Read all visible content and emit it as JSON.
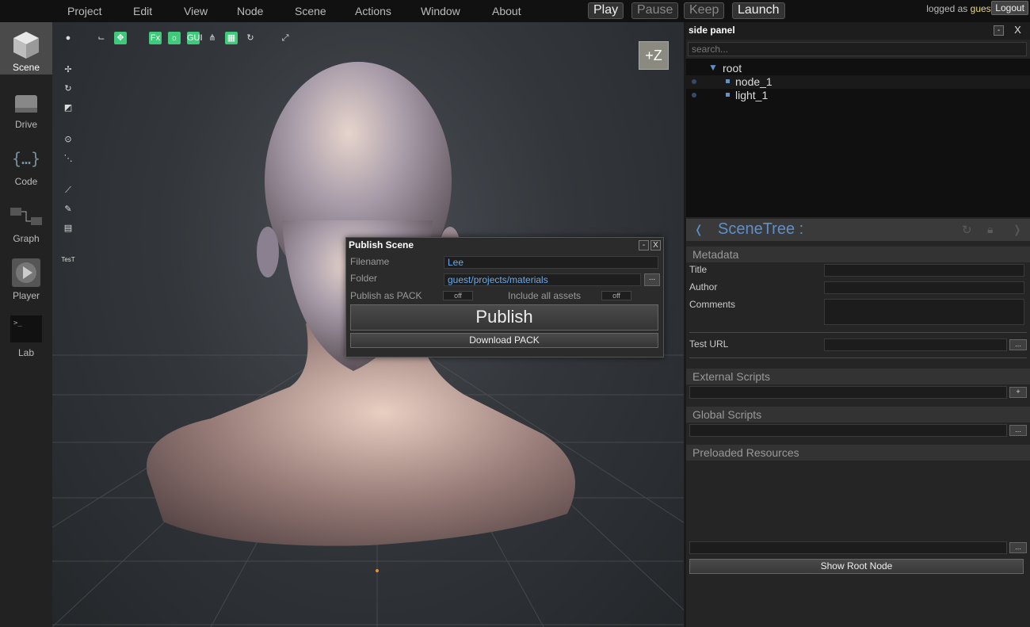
{
  "menubar": {
    "items": [
      "Project",
      "Edit",
      "View",
      "Node",
      "Scene",
      "Actions",
      "Window",
      "About"
    ],
    "play": "Play",
    "pause": "Pause",
    "keep": "Keep",
    "launch": "Launch",
    "login_prefix": "logged as",
    "user": "guest",
    "logout": "Logout"
  },
  "sidebar": {
    "items": [
      {
        "label": "Scene",
        "icon": "cube-icon",
        "active": true
      },
      {
        "label": "Drive",
        "icon": "drive-icon"
      },
      {
        "label": "Code",
        "icon": "code-braces-icon"
      },
      {
        "label": "Graph",
        "icon": "graph-icon"
      },
      {
        "label": "Player",
        "icon": "play-icon"
      },
      {
        "label": "Lab",
        "icon": "terminal-icon"
      }
    ]
  },
  "viewport": {
    "axis_button": "+Z",
    "test_label": "TesT",
    "tool_fx": "Fx",
    "tool_gui": "GUI"
  },
  "publish_dialog": {
    "title": "Publish Scene",
    "filename_label": "Filename",
    "filename_value": "Lee",
    "folder_label": "Folder",
    "folder_value": "guest/projects/materials",
    "folder_browse": "...",
    "pack_label": "Publish as PACK",
    "pack_value": "off",
    "assets_label": "Include all assets",
    "assets_value": "off",
    "publish_button": "Publish",
    "download_button": "Download PACK",
    "minimize": "-",
    "close": "X"
  },
  "side_panel": {
    "title": "side panel",
    "minimize": "-",
    "close": "X",
    "search_placeholder": "search...",
    "tree": {
      "root": "root",
      "nodes": [
        "node_1",
        "light_1"
      ]
    },
    "inspector": {
      "title": "SceneTree :",
      "metadata_head": "Metadata",
      "title_label": "Title",
      "author_label": "Author",
      "comments_label": "Comments",
      "test_url_label": "Test URL",
      "external_scripts_head": "External Scripts",
      "global_scripts_head": "Global Scripts",
      "preloaded_head": "Preloaded Resources",
      "browse": "...",
      "add": "+",
      "show_root_button": "Show Root Node"
    }
  }
}
